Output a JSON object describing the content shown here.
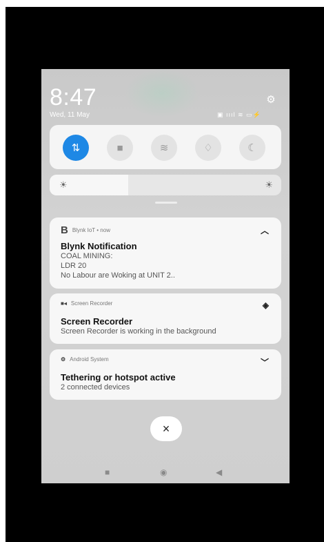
{
  "status": {
    "time": "8:47",
    "date": "Wed, 11 May",
    "settings_icon": "gear-icon",
    "status_icons": "signal wifi battery"
  },
  "quick_settings": [
    {
      "name": "data-toggle",
      "icon": "⇅",
      "active": true
    },
    {
      "name": "screen-record",
      "icon": "■",
      "active": false
    },
    {
      "name": "wifi",
      "icon": "≋",
      "active": false
    },
    {
      "name": "bell",
      "icon": "♢",
      "active": false
    },
    {
      "name": "moon",
      "icon": "☾",
      "active": false
    }
  ],
  "brightness": {
    "level": 0.34
  },
  "notifications": {
    "blynk": {
      "app": "Blynk IoT • now",
      "title": "Blynk Notification",
      "line1": "COAL MINING:",
      "line2": "LDR 20",
      "line3": "No Labour are Woking at UNIT 2.."
    },
    "recorder": {
      "app": "Screen Recorder",
      "title": "Screen Recorder",
      "body": "Screen Recorder is working in the background"
    },
    "android": {
      "app": "Android System",
      "title": "Tethering or hotspot active",
      "body": "2 connected devices"
    }
  },
  "dismiss_label": "×",
  "nav": {
    "recent": "■",
    "home": "◉",
    "back": "◀"
  }
}
